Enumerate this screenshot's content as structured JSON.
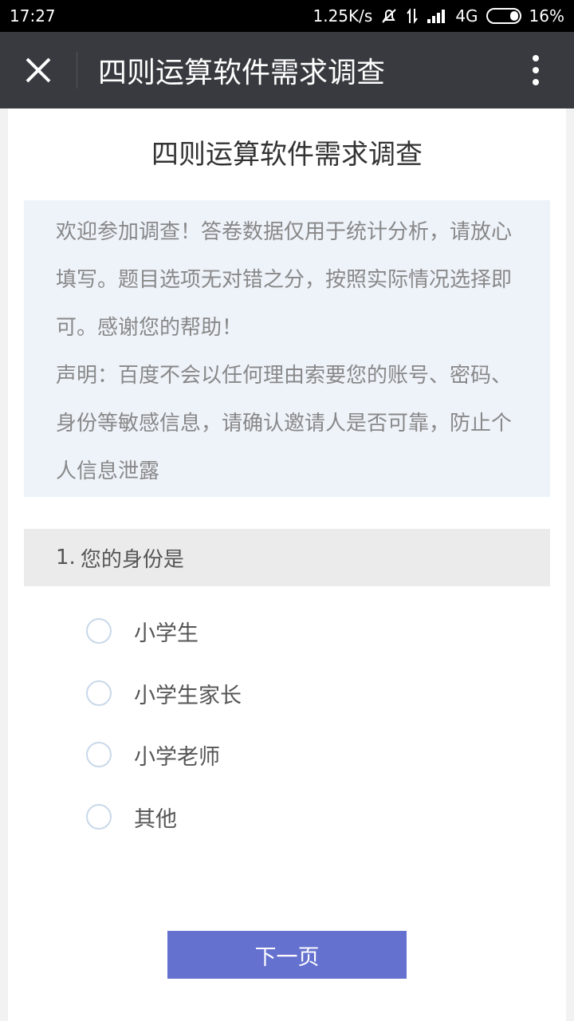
{
  "status_bar": {
    "time": "17:27",
    "speed": "1.25K/s",
    "network": "4G",
    "battery": "16%",
    "battery_level": 0.16
  },
  "title_bar": {
    "title": "四则运算软件需求调查"
  },
  "survey": {
    "title": "四则运算软件需求调查",
    "intro_lines": [
      "欢迎参加调查！答卷数据仅用于统计分析，请放心填写。题目选项无对错之分，按照实际情况选择即可。感谢您的帮助！",
      "声明：百度不会以任何理由索要您的账号、密码、身份等敏感信息，请确认邀请人是否可靠，防止个人信息泄露"
    ],
    "question": {
      "number": "1.",
      "text": "您的身份是",
      "options": [
        "小学生",
        "小学生家长",
        "小学老师",
        "其他"
      ]
    },
    "next_button": "下一页"
  },
  "colors": {
    "title_bar_bg": "#393a3f",
    "intro_bg": "#eef3fa",
    "button_bg": "#6571cf"
  }
}
